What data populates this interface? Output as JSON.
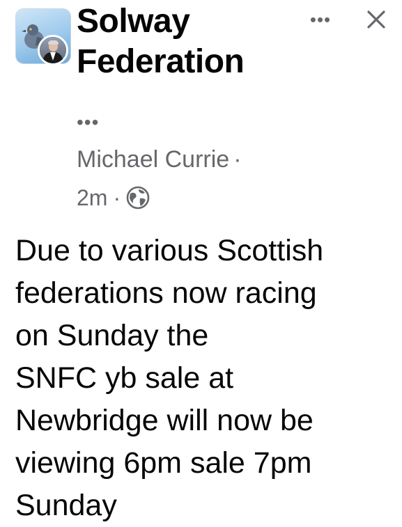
{
  "header": {
    "group_name_line1": "Solway",
    "group_name_line2": "Federation",
    "more_label": "•••",
    "close_label": "✕",
    "avatar_icon": "group-avatar-icon",
    "member_avatar_icon": "member-avatar-icon"
  },
  "post": {
    "sub_menu_dots": "•••",
    "author": "Michael Currie",
    "separator": "·",
    "timestamp": "2m",
    "audience_icon": "globe-icon",
    "body": "Due to various Scottish\nfederations now racing\non Sunday the\nSNFC yb sale at\nNewbridge will now be\nviewing 6pm sale 7pm\nSunday"
  },
  "colors": {
    "primary_text": "#050505",
    "secondary_text": "#65676b",
    "background": "#ffffff"
  }
}
